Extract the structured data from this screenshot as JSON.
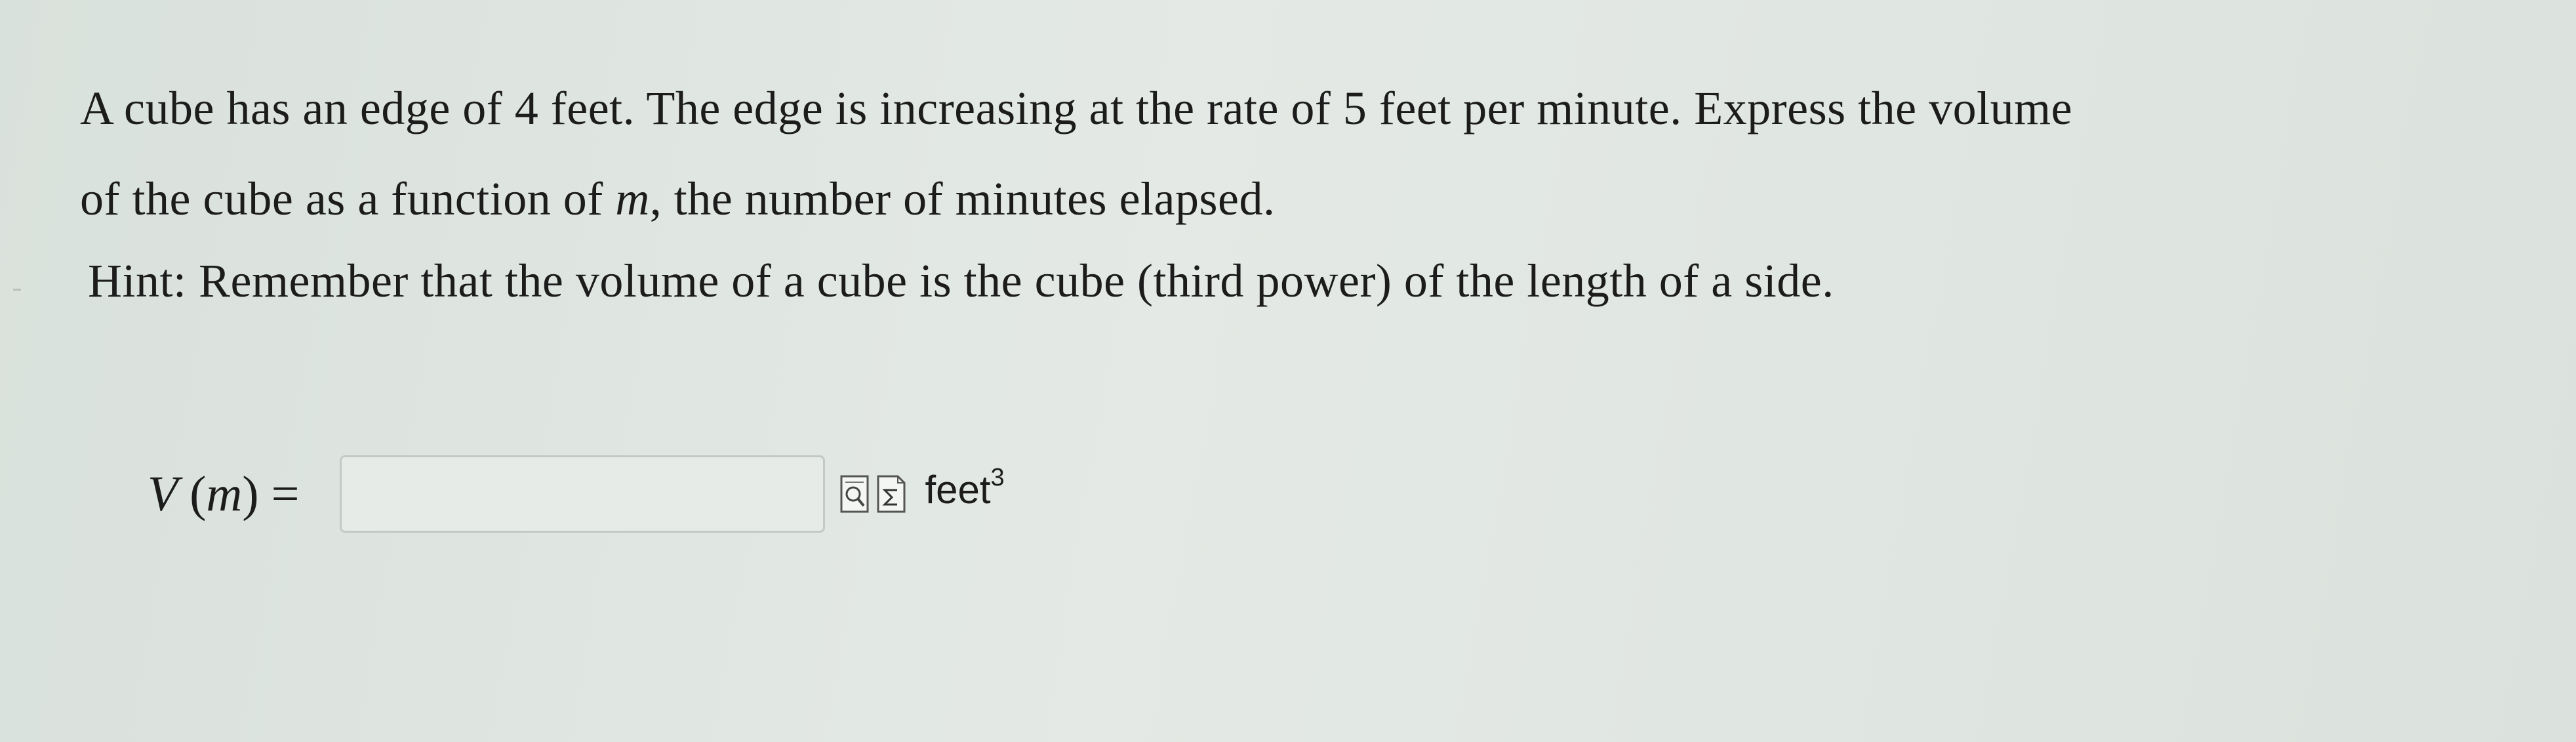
{
  "question": {
    "line1": "A cube has an edge of 4 feet. The edge is increasing at the rate of 5 feet per minute. Express the volume",
    "line2_prefix": "of the cube as a function of ",
    "line2_var": "m",
    "line2_suffix": ", the number of minutes elapsed."
  },
  "hint": "Hint: Remember that the volume of a cube is the cube (third power) of the length of a side.",
  "answer": {
    "function_name": "V",
    "open_paren": "(",
    "variable": "m",
    "close_paren": ")",
    "equals": "=",
    "input_value": "",
    "unit": "feet",
    "unit_exponent": "3"
  },
  "icons": {
    "preview": "preview-answer-icon",
    "equation_editor": "sigma-equation-icon"
  }
}
